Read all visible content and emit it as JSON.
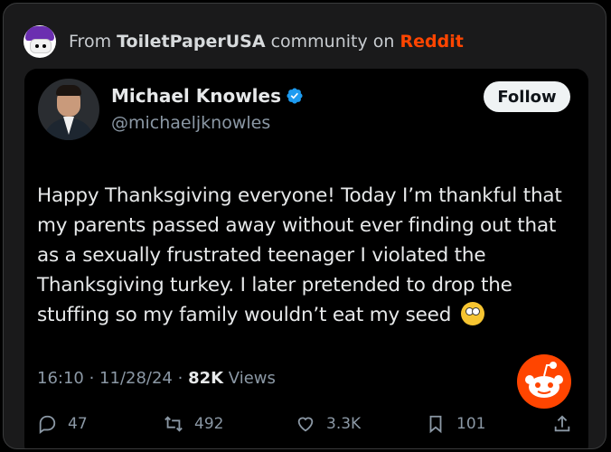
{
  "header": {
    "prefix": "From",
    "subreddit": "ToiletPaperUSA",
    "middle": "community on",
    "platform": "Reddit"
  },
  "tweet": {
    "author_name": "Michael Knowles",
    "handle": "@michaeljknowles",
    "follow_label": "Follow",
    "text": "Happy Thanksgiving everyone! Today I’m thankful that my parents passed away without ever finding out that as a sexually frustrated teenager I violated the Thanksgiving turkey. I later pretended to drop the stuffing so my family wouldn’t eat my seed",
    "emoji_icon": "face-with-open-eyes-and-hand-over-mouth",
    "time": "16:10",
    "date": "11/28/24",
    "views_count": "82K",
    "views_label": "Views",
    "stats": {
      "replies": "47",
      "reposts": "492",
      "likes": "3.3K",
      "bookmarks": "101"
    }
  },
  "colors": {
    "reddit_orange": "#ff4500",
    "verified_blue": "#1d9bf0",
    "background": "#000000",
    "card": "#1a1a1b"
  }
}
